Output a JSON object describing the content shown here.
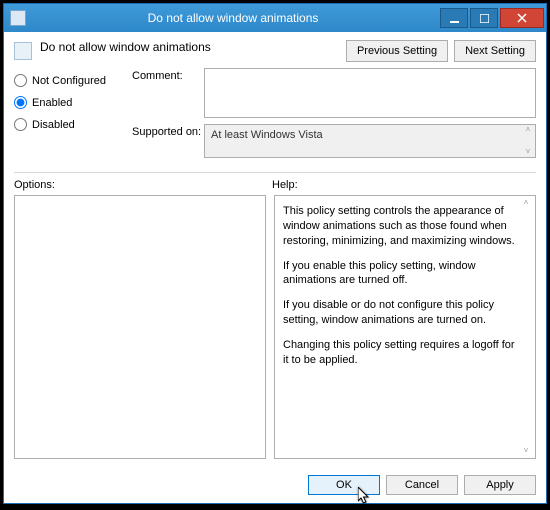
{
  "window": {
    "title": "Do not allow window animations"
  },
  "header": {
    "title": "Do not allow window animations",
    "prev_label": "Previous Setting",
    "next_label": "Next Setting"
  },
  "radios": {
    "not_configured": "Not Configured",
    "enabled": "Enabled",
    "disabled": "Disabled",
    "selected": "enabled"
  },
  "fields": {
    "comment_label": "Comment:",
    "comment_value": "",
    "supported_label": "Supported on:",
    "supported_value": "At least Windows Vista"
  },
  "panes": {
    "options_label": "Options:",
    "help_label": "Help:",
    "help_text": {
      "p1": "This policy setting controls the appearance of window animations such as those found when restoring, minimizing, and maximizing windows.",
      "p2": "If you enable this policy setting, window animations are turned off.",
      "p3": "If you disable or do not configure this policy setting, window animations are turned on.",
      "p4": "Changing this policy setting requires a logoff for it to be applied."
    }
  },
  "footer": {
    "ok": "OK",
    "cancel": "Cancel",
    "apply": "Apply"
  }
}
